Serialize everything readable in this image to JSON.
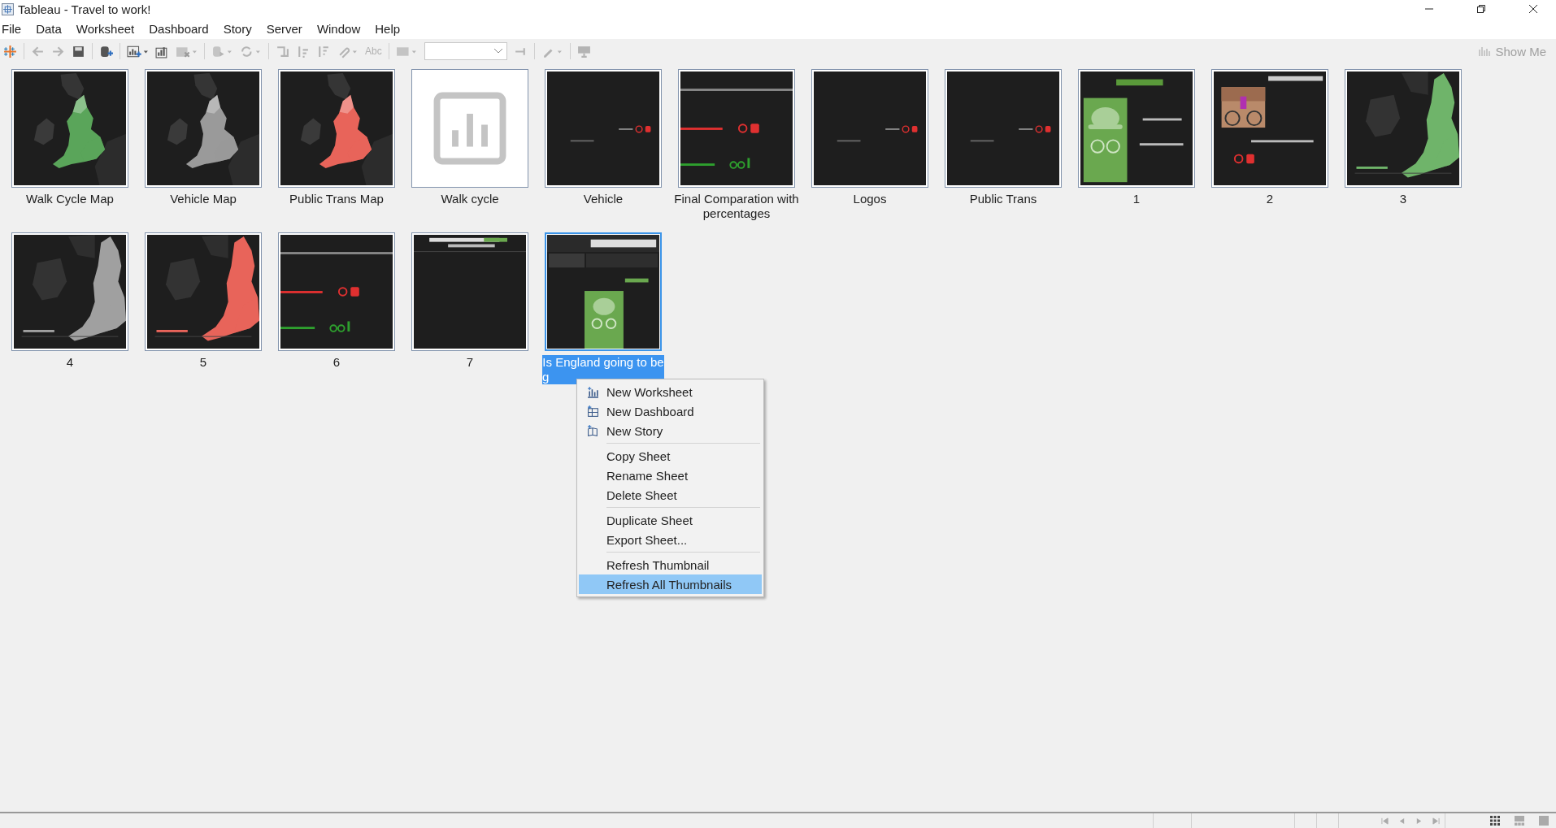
{
  "window": {
    "title": "Tableau - Travel to work!"
  },
  "menu_bar": [
    "File",
    "Data",
    "Worksheet",
    "Dashboard",
    "Story",
    "Server",
    "Window",
    "Help"
  ],
  "toolbar": {
    "text_button": "Abc",
    "show_me": "Show Me"
  },
  "sheets": [
    {
      "label": "Walk Cycle Map",
      "kind": "walkmap",
      "selected": false
    },
    {
      "label": "Vehicle Map",
      "kind": "vehiclemap",
      "selected": false
    },
    {
      "label": "Public Trans Map",
      "kind": "transitmap",
      "selected": false
    },
    {
      "label": "Walk cycle",
      "kind": "placeholder",
      "selected": false
    },
    {
      "label": "Vehicle",
      "kind": "marks",
      "selected": false
    },
    {
      "label": "Final Comparation with percentages",
      "kind": "lines",
      "selected": false
    },
    {
      "label": "Logos",
      "kind": "marks",
      "selected": false
    },
    {
      "label": "Public Trans",
      "kind": "marks",
      "selected": false
    },
    {
      "label": "1",
      "kind": "poster",
      "selected": false
    },
    {
      "label": "2",
      "selected": false
    },
    {
      "label": "3",
      "kind": "walkzoom",
      "selected": false
    },
    {
      "label": "4",
      "kind": "vehiclezoom",
      "selected": false
    },
    {
      "label": "5",
      "kind": "transitzoom",
      "selected": false
    },
    {
      "label": "6",
      "kind": "lines",
      "selected": false
    },
    {
      "label": "7",
      "kind": "header",
      "selected": false
    },
    {
      "label": "Is England going to be g",
      "kind": "dashboard",
      "selected": true
    }
  ],
  "context_menu": {
    "groups": [
      [
        {
          "label": "New Worksheet",
          "kind": "worksheet",
          "selected": false
        },
        {
          "label": "New Dashboard",
          "kind": "dashboard",
          "selected": false
        },
        {
          "label": "New Story",
          "kind": "story",
          "selected": false
        }
      ],
      [
        {
          "label": "Copy Sheet",
          "kind": "text",
          "selected": false
        },
        {
          "label": "Rename Sheet",
          "kind": "text",
          "selected": false
        },
        {
          "label": "Delete Sheet",
          "kind": "text",
          "selected": false
        }
      ],
      [
        {
          "label": "Duplicate Sheet",
          "kind": "text",
          "selected": false
        },
        {
          "label": "Export Sheet...",
          "kind": "text",
          "selected": false
        }
      ],
      [
        {
          "label": "Refresh Thumbnail",
          "kind": "text",
          "selected": false
        },
        {
          "label": "Refresh All Thumbnails",
          "kind": "text",
          "selected": true
        }
      ]
    ]
  }
}
